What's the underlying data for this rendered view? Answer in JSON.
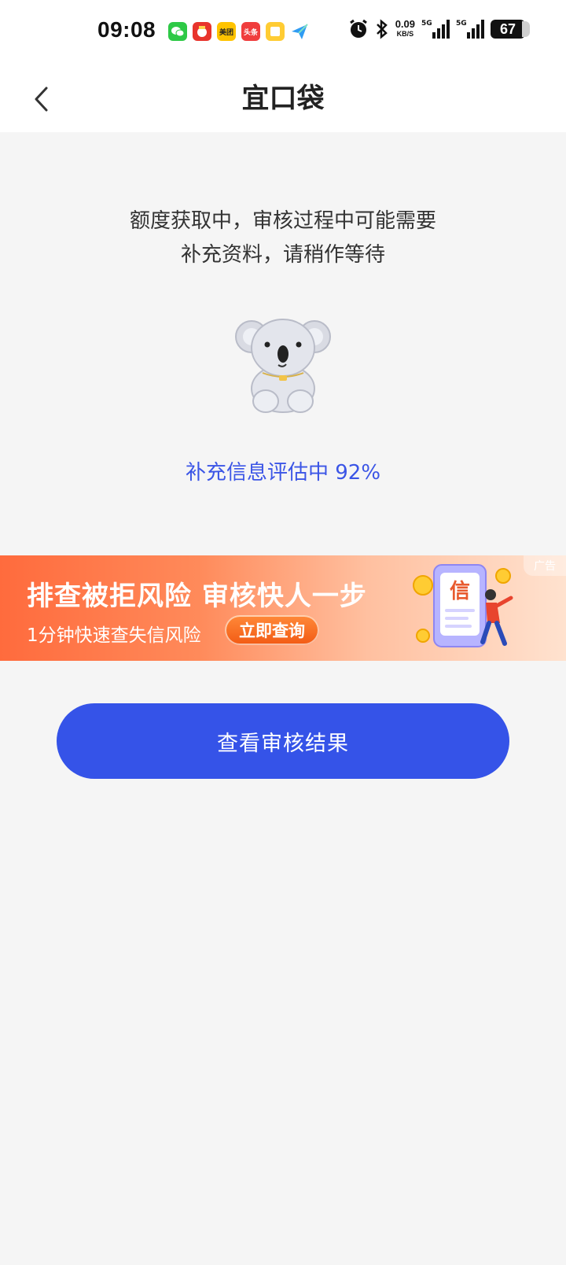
{
  "status_bar": {
    "time": "09:08",
    "app_icons": [
      {
        "name": "wechat-icon",
        "color": "#2ec946",
        "label": ""
      },
      {
        "name": "news-app-icon",
        "color": "#e8342c",
        "label": ""
      },
      {
        "name": "meituan-icon",
        "color": "#ffc300",
        "label": "美团"
      },
      {
        "name": "toutiao-icon",
        "color": "#f03d3d",
        "label": "头条"
      },
      {
        "name": "notes-icon",
        "color": "#ffcc33",
        "label": ""
      },
      {
        "name": "send-icon",
        "color": "#2f9cf3",
        "label": ""
      }
    ],
    "net_speed_value": "0.09",
    "net_speed_unit": "KB/S",
    "signal_1_gen": "5G",
    "signal_2_gen": "5G",
    "battery": "67"
  },
  "nav": {
    "title": "宜口袋"
  },
  "main": {
    "status_line_1": "额度获取中，审核过程中可能需要",
    "status_line_2": "补充资料，请稍作等待",
    "progress_label": "补充信息评估中 92%",
    "progress_value": 92
  },
  "ad": {
    "title": "排查被拒风险  审核快人一步",
    "subtitle": "1分钟快速查失信风险",
    "cta": "立即查询",
    "tag": "广告",
    "illustration_text": "信"
  },
  "actions": {
    "view_result": "查看审核结果"
  },
  "colors": {
    "primary": "#3553e8",
    "progress_text": "#3b55e6",
    "ad_orange": "#ff6b3d"
  }
}
